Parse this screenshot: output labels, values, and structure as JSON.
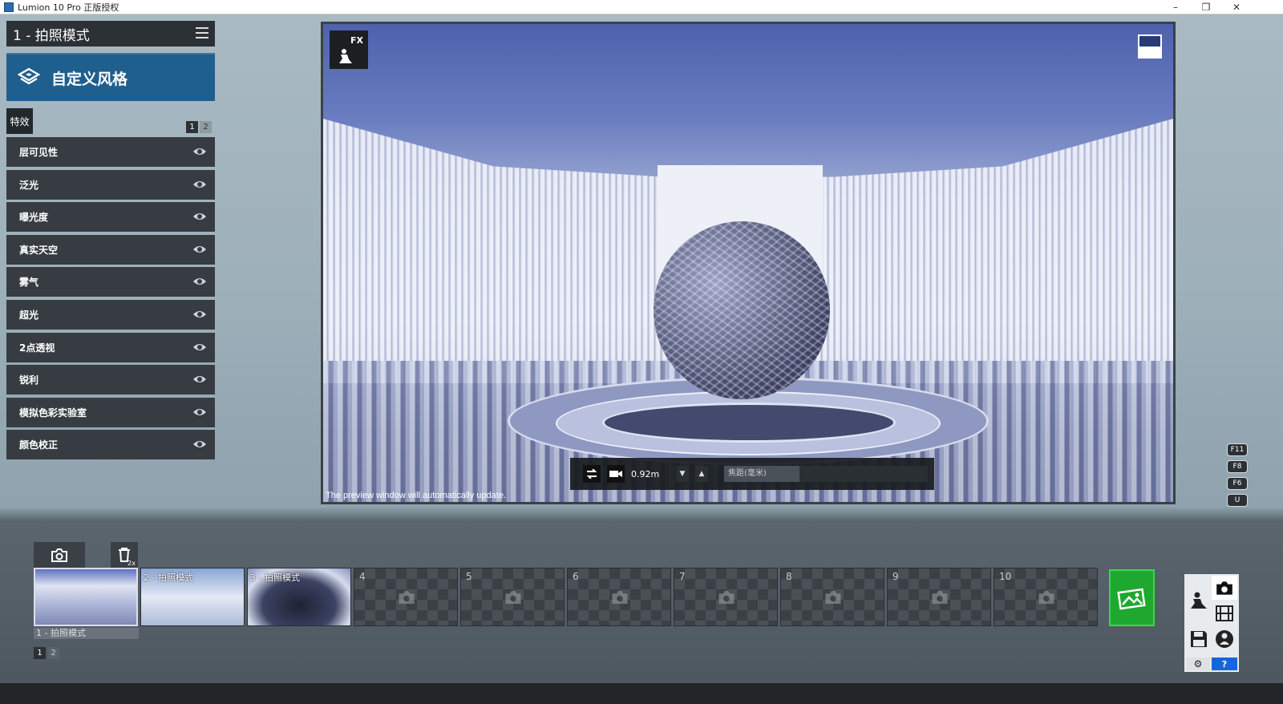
{
  "window": {
    "title": "Lumion 10 Pro 正版授权",
    "minimize": "–",
    "restore": "❐",
    "close": "✕"
  },
  "left_panel": {
    "mode_title": "1 - 拍照模式",
    "style_button": "自定义风格",
    "fx_tab": "特效",
    "fx_pages": [
      "1",
      "2"
    ],
    "effects": [
      "层可见性",
      "泛光",
      "曝光度",
      "真实天空",
      "雾气",
      "超光",
      "2点透视",
      "锐利",
      "模拟色彩实验室",
      "颜色校正"
    ]
  },
  "viewport": {
    "fx_badge": "FX",
    "preview_note": "The preview window will automatically update.",
    "camera_height": "0.92m",
    "focal_label": "焦距(毫米)",
    "focal_fraction": 0.37
  },
  "hotkeys": [
    "F11",
    "F8",
    "F6",
    "U"
  ],
  "thumbnails": {
    "slots": [
      {
        "num": "1",
        "label": ""
      },
      {
        "num": "2",
        "label": "2 - 拍照模式"
      },
      {
        "num": "3",
        "label": "3 - 拍照模式"
      },
      {
        "num": "4",
        "label": ""
      },
      {
        "num": "5",
        "label": ""
      },
      {
        "num": "6",
        "label": ""
      },
      {
        "num": "7",
        "label": ""
      },
      {
        "num": "8",
        "label": ""
      },
      {
        "num": "9",
        "label": ""
      },
      {
        "num": "10",
        "label": ""
      }
    ],
    "selected_caption": "1 - 拍照模式",
    "delete_hint": "2x",
    "pages": [
      "1",
      "2"
    ]
  },
  "mode_selector": {
    "help": "?",
    "settings": "⚙"
  },
  "colors": {
    "accent_blue": "#1f5f8e",
    "panel_dark": "#363c41",
    "render_green": "#1fa82f",
    "help_blue": "#1268d8"
  }
}
